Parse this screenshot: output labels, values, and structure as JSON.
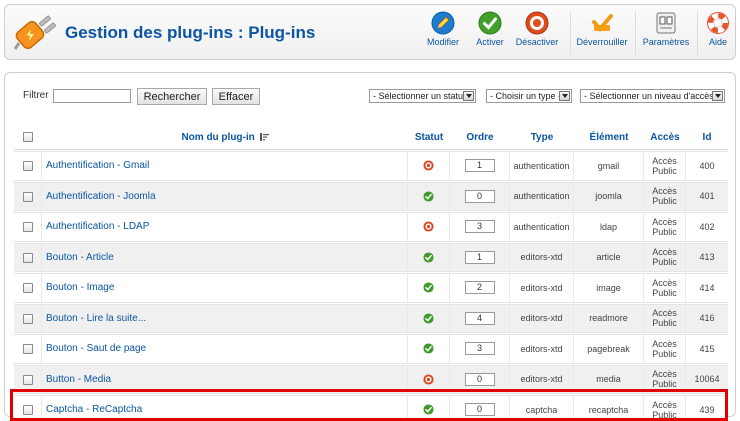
{
  "header": {
    "title": "Gestion des plug-ins : Plug-ins",
    "toolbar": [
      {
        "label": "Modifier",
        "icon": "pencil-icon"
      },
      {
        "label": "Activer",
        "icon": "check-icon"
      },
      {
        "label": "Désactiver",
        "icon": "disable-icon"
      },
      {
        "label": "Déverrouiller",
        "icon": "unlock-check-icon"
      },
      {
        "label": "Paramètres",
        "icon": "settings-icon"
      },
      {
        "label": "Aide",
        "icon": "help-icon"
      }
    ]
  },
  "filter": {
    "label": "Filtrer",
    "value": "",
    "search_button": "Rechercher",
    "reset_button": "Effacer",
    "selects": [
      {
        "value": "- Sélectionner un statut -"
      },
      {
        "value": "- Choisir un type -"
      },
      {
        "value": "- Sélectionner un niveau d'accès -"
      }
    ]
  },
  "table": {
    "columns": {
      "name": "Nom du plug-in",
      "status": "Statut",
      "order": "Ordre",
      "type": "Type",
      "element": "Élément",
      "access": "Accès",
      "id": "Id"
    },
    "rows": [
      {
        "name": "Authentification - Gmail",
        "status": "disabled",
        "order": "1",
        "type": "authentication",
        "element": "gmail",
        "access_line1": "Accès",
        "access_line2": "Public",
        "id": "400"
      },
      {
        "name": "Authentification - Joomla",
        "status": "enabled",
        "order": "0",
        "type": "authentication",
        "element": "joomla",
        "access_line1": "Accès",
        "access_line2": "Public",
        "id": "401"
      },
      {
        "name": "Authentification - LDAP",
        "status": "disabled",
        "order": "3",
        "type": "authentication",
        "element": "ldap",
        "access_line1": "Accès",
        "access_line2": "Public",
        "id": "402"
      },
      {
        "name": "Bouton - Article",
        "status": "enabled",
        "order": "1",
        "type": "editors-xtd",
        "element": "article",
        "access_line1": "Accès",
        "access_line2": "Public",
        "id": "413"
      },
      {
        "name": "Bouton - Image",
        "status": "enabled",
        "order": "2",
        "type": "editors-xtd",
        "element": "image",
        "access_line1": "Accès",
        "access_line2": "Public",
        "id": "414"
      },
      {
        "name": "Bouton - Lire la suite...",
        "status": "enabled",
        "order": "4",
        "type": "editors-xtd",
        "element": "readmore",
        "access_line1": "Accès",
        "access_line2": "Public",
        "id": "416"
      },
      {
        "name": "Bouton - Saut de page",
        "status": "enabled",
        "order": "3",
        "type": "editors-xtd",
        "element": "pagebreak",
        "access_line1": "Accès",
        "access_line2": "Public",
        "id": "415"
      },
      {
        "name": "Button - Media",
        "status": "disabled",
        "order": "0",
        "type": "editors-xtd",
        "element": "media",
        "access_line1": "Accès",
        "access_line2": "Public",
        "id": "10064"
      },
      {
        "name": "Captcha - ReCaptcha",
        "status": "enabled",
        "order": "0",
        "type": "captcha",
        "element": "recaptcha",
        "access_line1": "Accès",
        "access_line2": "Public",
        "id": "439"
      }
    ]
  },
  "colors": {
    "accent": "#0b55a3",
    "enabled": "#3f9a2a",
    "disabled": "#d9481c",
    "highlight": "#e10000"
  }
}
